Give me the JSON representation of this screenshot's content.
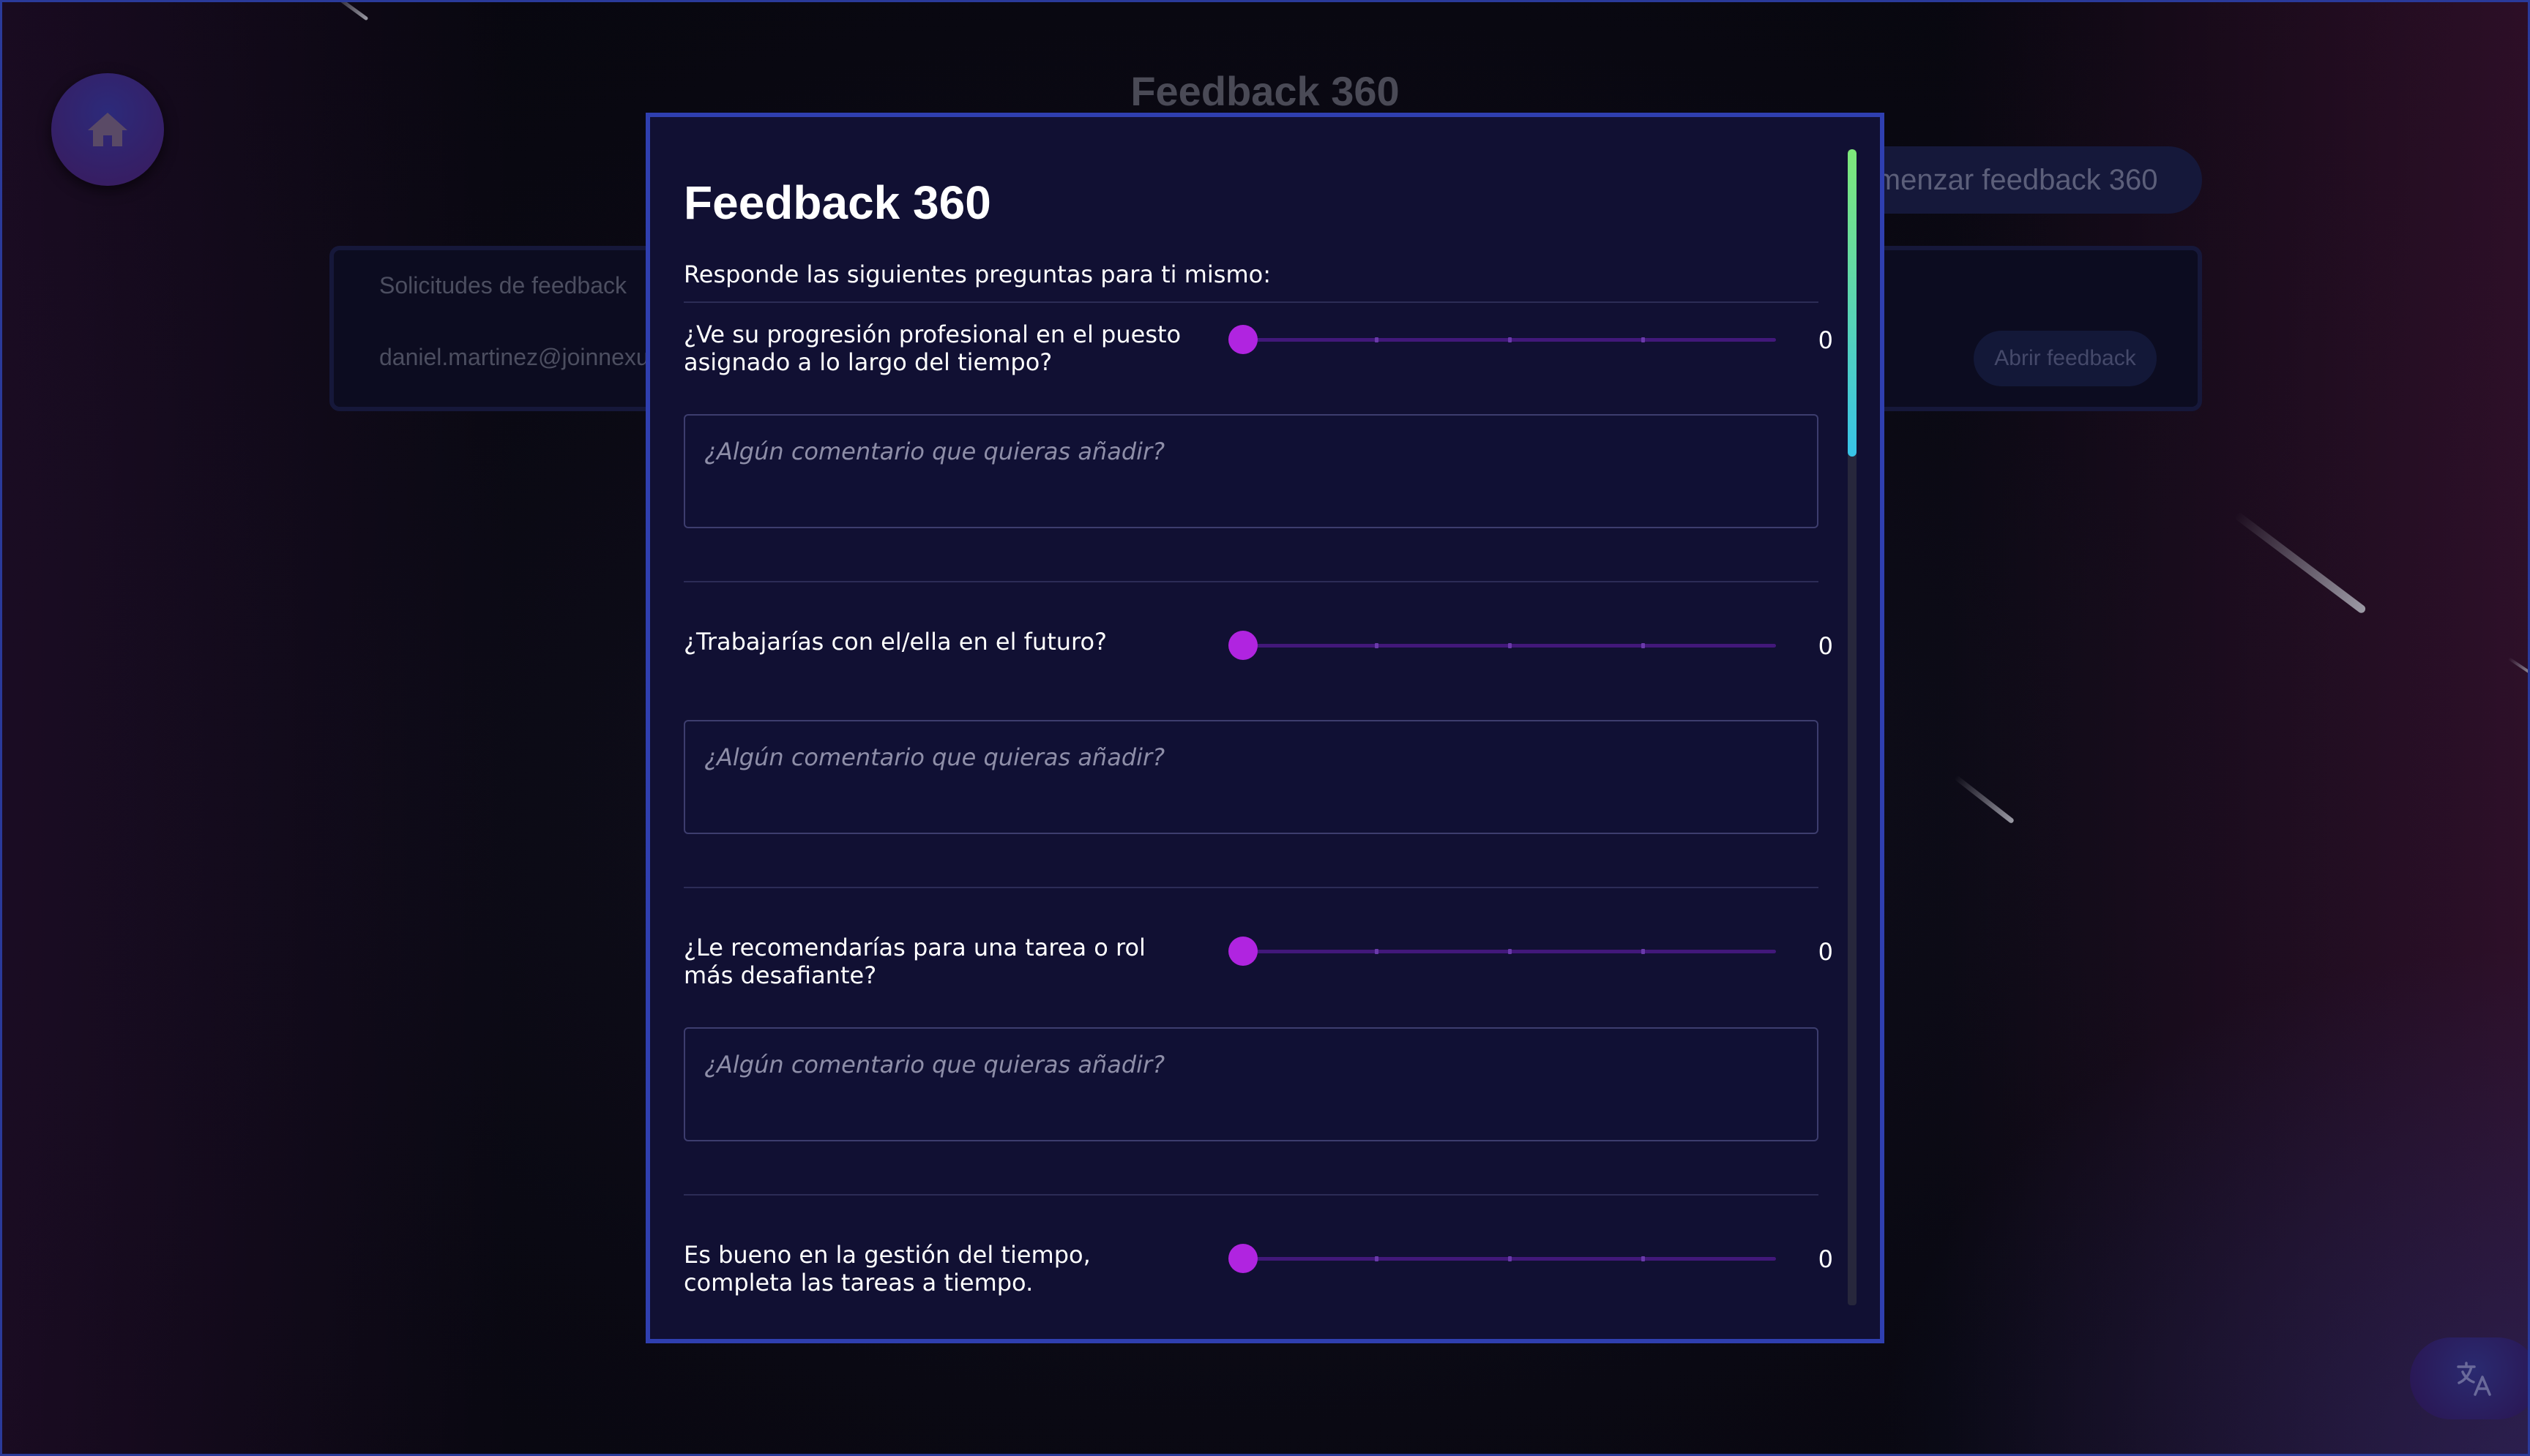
{
  "background": {
    "title": "Feedback 360",
    "start_button": "omenzar feedback 360",
    "card": {
      "label": "Solicitudes de feedback",
      "email": "daniel.martinez@joinnexu",
      "open_button": "Abrir feedback"
    }
  },
  "modal": {
    "title": "Feedback 360",
    "subtitle": "Responde las siguientes preguntas para ti mismo:",
    "questions": [
      {
        "text": "¿Ve su progresión profesional en el puesto asignado a lo largo del tiempo?",
        "value": "0",
        "comment_placeholder": "¿Algún comentario que quieras añadir?"
      },
      {
        "text": "¿Trabajarías con el/ella en el futuro?",
        "value": "0",
        "comment_placeholder": "¿Algún comentario que quieras añadir?"
      },
      {
        "text": "¿Le recomendarías para una tarea o rol más desafiante?",
        "value": "0",
        "comment_placeholder": "¿Algún comentario que quieras añadir?"
      },
      {
        "text": "Es bueno en la gestión del tiempo, completa las tareas a tiempo.",
        "value": "0"
      }
    ]
  },
  "icons": {
    "home": "home-icon",
    "translate": "translate-icon"
  },
  "colors": {
    "accent": "#b024e0",
    "modal_border": "#2f3fb0",
    "modal_bg": "#111033"
  }
}
